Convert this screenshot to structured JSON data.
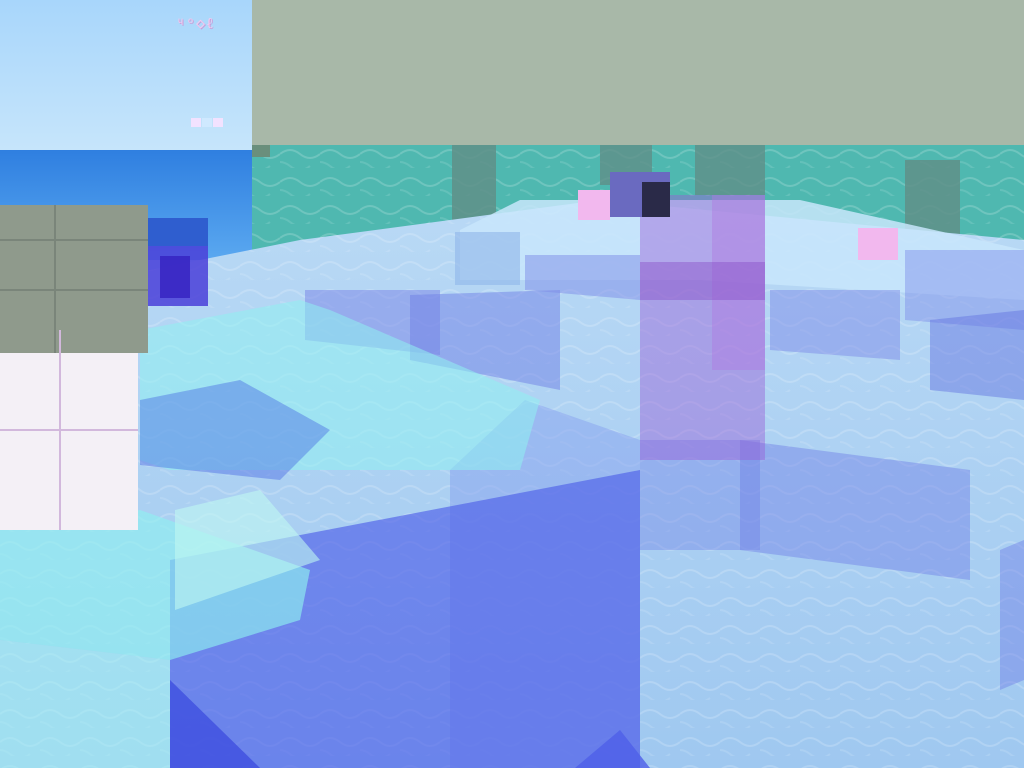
{
  "game": {
    "hud_glyphs": "ᶣᵒ◇ℓ",
    "palette": {
      "sky": "#9fd0f5",
      "sea": "#3f8fe6",
      "fog": "#a8b8a8",
      "water_top": "#b6d6f5",
      "water_blue": "#6f7fe6",
      "cyan_glass": "#8ff0f0",
      "purple_glass": "#9a5fd8",
      "pink_block": "#f2b8ee",
      "white_block": "#f4f0f6"
    }
  }
}
